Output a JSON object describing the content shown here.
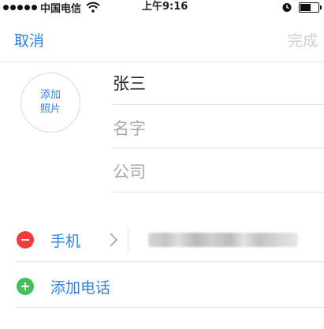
{
  "status_bar": {
    "carrier": "中国电信",
    "time": "上午9:16",
    "icons": [
      "signal-dots",
      "wifi-icon",
      "alarm-icon",
      "battery-icon"
    ]
  },
  "nav": {
    "cancel_label": "取消",
    "done_label": "完成"
  },
  "avatar": {
    "line1": "添加",
    "line2": "照片"
  },
  "fields": {
    "name_value": "张三",
    "first_name_placeholder": "名字",
    "company_placeholder": "公司"
  },
  "phone": {
    "label": "手机",
    "value_obscured": true
  },
  "add_phone": {
    "label": "添加电话"
  },
  "colors": {
    "accent": "#2f7fe8",
    "delete": "#f03c3c",
    "add": "#3fc25a",
    "disabled": "#cfcfcf"
  }
}
